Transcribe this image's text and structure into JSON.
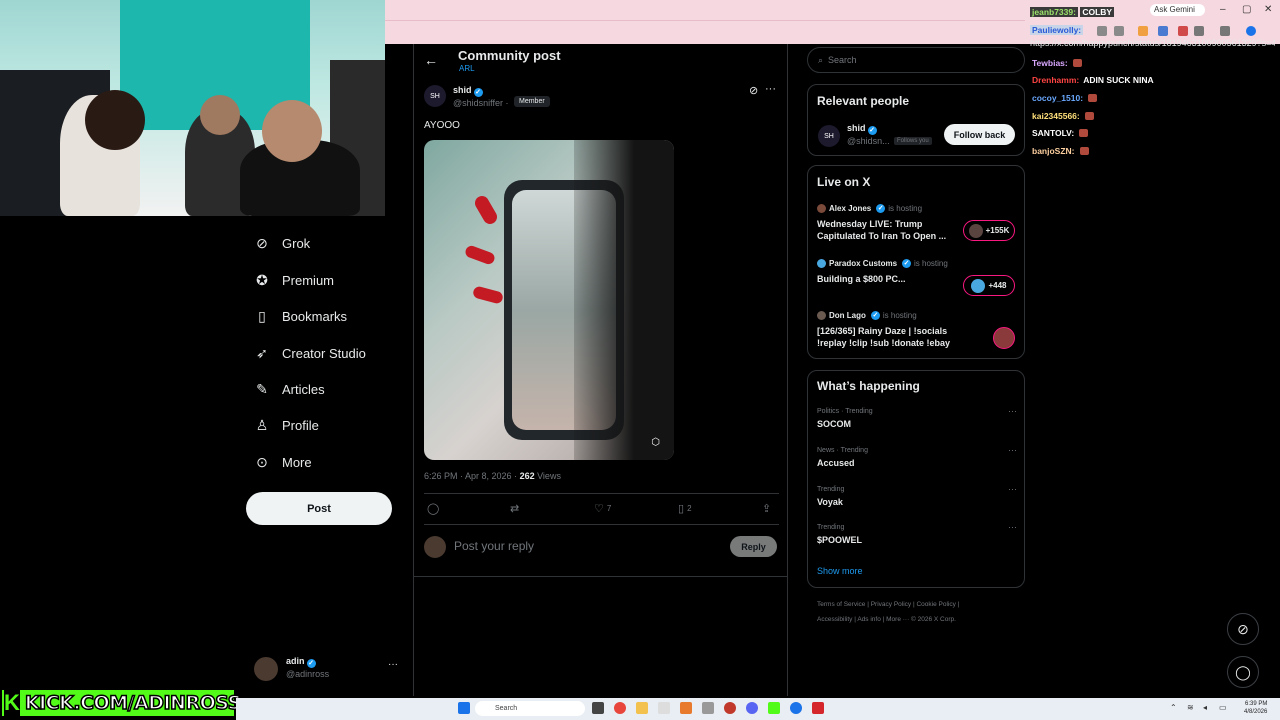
{
  "browser": {
    "ask_gemini": "Ask Gemini",
    "url": "https://x.com/happypunch/status/1819463100900561329?s=46",
    "window_controls": [
      "–",
      "▢",
      "✕"
    ]
  },
  "nav": {
    "items": [
      {
        "label": "Grok",
        "icon": "grok-icon"
      },
      {
        "label": "Premium",
        "icon": "premium-icon"
      },
      {
        "label": "Bookmarks",
        "icon": "bookmark-icon"
      },
      {
        "label": "Creator Studio",
        "icon": "rocket-icon"
      },
      {
        "label": "Articles",
        "icon": "articles-icon"
      },
      {
        "label": "Profile",
        "icon": "person-icon"
      },
      {
        "label": "More",
        "icon": "more-circle-icon"
      }
    ],
    "post_button": "Post",
    "account": {
      "name": "adin",
      "handle": "@adinross"
    }
  },
  "main": {
    "title": "Community post",
    "subtitle": "ARL",
    "author": {
      "initials": "SH",
      "name": "shid",
      "handle": "@shidsniffer",
      "separator": "·",
      "badge": "Member"
    },
    "text": "AYOOO",
    "meta": {
      "time": "6:26 PM · Apr 8, 2026 · ",
      "views_count": "262",
      "views_label": " Views"
    },
    "actions": {
      "likes": "7",
      "bookmarks": "2"
    },
    "reply_placeholder": "Post your reply",
    "reply_button": "Reply"
  },
  "right": {
    "search_placeholder": "Search",
    "relevant": {
      "title": "Relevant people",
      "person": {
        "initials": "SH",
        "name": "shid",
        "handle": "@shidsn...",
        "follows": "Follows you"
      },
      "follow_button": "Follow back"
    },
    "live": {
      "title": "Live on X",
      "hosting_label": "is hosting",
      "items": [
        {
          "host": "Alex Jones",
          "title": "Wednesday LIVE: Trump Capitulated To Iran To Open ...",
          "count": "+155K"
        },
        {
          "host": "Paradox Customs",
          "title": "Building a $800 PC...",
          "count": "+448"
        },
        {
          "host": "Don Lago",
          "title": "[126/365] Rainy Daze | !socials !replay !clip !sub !donate !ebay",
          "count": ""
        }
      ]
    },
    "happening": {
      "title": "What’s happening",
      "trends": [
        {
          "category": "Politics · Trending",
          "name": "SOCOM"
        },
        {
          "category": "News · Trending",
          "name": "Accused"
        },
        {
          "category": "Trending",
          "name": "Voyak"
        },
        {
          "category": "Trending",
          "name": "$POOWEL"
        }
      ],
      "show_more": "Show more"
    },
    "footer": {
      "line1": "Terms of Service  |  Privacy Policy  |  Cookie Policy  |",
      "line2": "Accessibility  |  Ads info  |  More ···  © 2026 X Corp."
    }
  },
  "chat": [
    {
      "user": "jeanb7339:",
      "msg": "COLBY",
      "color": "#9be36a"
    },
    {
      "user": "Pauliewolly:",
      "msg": "",
      "color": "#7fa7ff"
    },
    {
      "user": "Tewbias:",
      "msg": "",
      "color": "#d9a8ff"
    },
    {
      "user": "Drenhamm:",
      "msg": "ADIN SUCK NINA",
      "color": "#ff4444"
    },
    {
      "user": "cocoy_1510:",
      "msg": "",
      "color": "#6aa9ff"
    },
    {
      "user": "kai2345566:",
      "msg": "",
      "color": "#ffe07a"
    },
    {
      "user": "SANTOLV:",
      "msg": "",
      "color": "#ffffff"
    },
    {
      "user": "banjoSZN:",
      "msg": "",
      "color": "#ffd0a0"
    }
  ],
  "kick": {
    "logo": "K",
    "text": "KICK.COM/ADINROSS"
  },
  "taskbar": {
    "search": "Search",
    "time": "6:39 PM",
    "date": "4/8/2026"
  },
  "colors": {
    "accent": "#1d9bf0",
    "kick_green": "#53fc18",
    "live_pink": "#f91880",
    "bg": "#000000"
  }
}
